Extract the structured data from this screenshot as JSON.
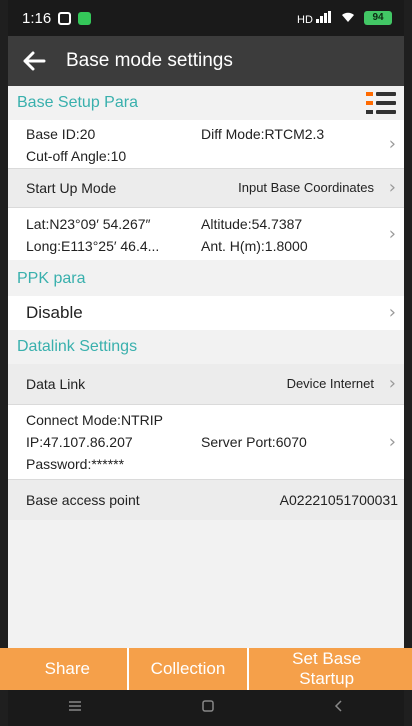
{
  "status_bar": {
    "time": "1:16",
    "signal": "HD",
    "battery": "94"
  },
  "app_bar": {
    "title": "Base mode settings"
  },
  "base_setup": {
    "header": "Base Setup Para",
    "base_id": "Base ID:20",
    "diff_mode": "Diff Mode:RTCM2.3",
    "cutoff": "Cut-off Angle:10",
    "startup_label": "Start Up Mode",
    "startup_value": "Input Base Coordinates",
    "lat": "Lat:N23°09′ 54.267″",
    "altitude": "Altitude:54.7387",
    "long": "Long:E113°25′ 46.4...",
    "ant_h": "Ant. H(m):1.8000"
  },
  "ppk": {
    "header": "PPK para",
    "value": "Disable"
  },
  "datalink": {
    "header": "Datalink Settings",
    "label": "Data Link",
    "value": "Device Internet",
    "connect_mode": "Connect Mode:NTRIP",
    "ip": "IP:47.107.86.207",
    "server_port": "Server Port:6070",
    "password": "Password:******",
    "access_label": "Base access point",
    "access_value": "A02221051700031"
  },
  "bottom_buttons": {
    "share": "Share",
    "collection": "Collection",
    "set_base": "Set Base Startup"
  },
  "colors": {
    "accent": "#39b0ad",
    "button": "#f5a04a",
    "appbar": "#3c3c3c"
  }
}
